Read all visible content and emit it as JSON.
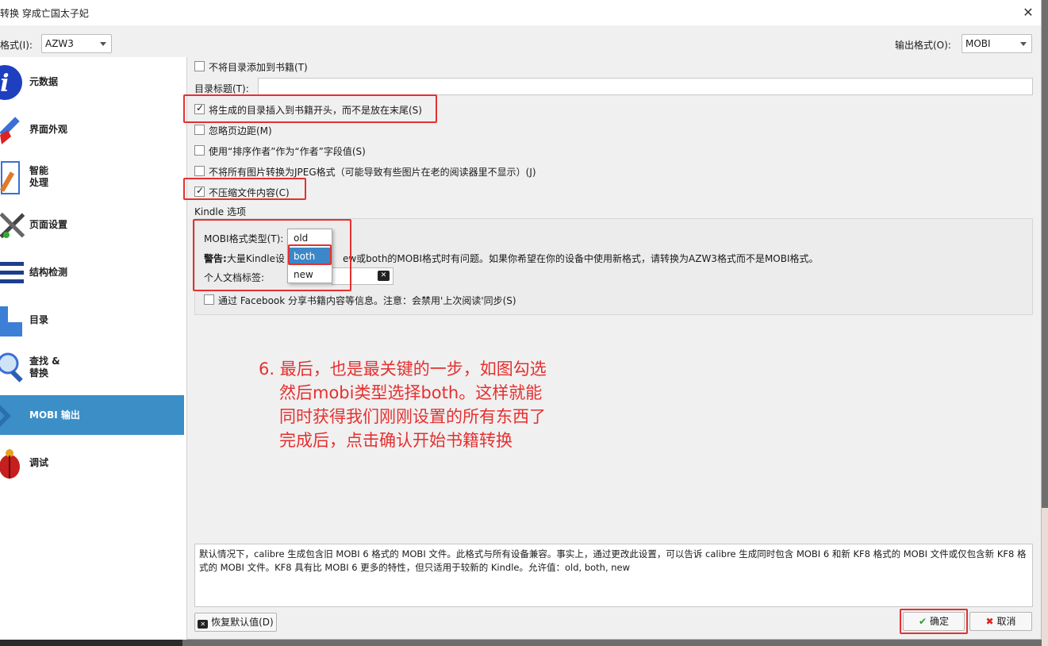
{
  "window": {
    "title": "转换 穿成亡国太子妃",
    "close_glyph": "✕"
  },
  "input_format": {
    "label": "格式(I):",
    "value": "AZW3"
  },
  "output_format": {
    "label": "输出格式(O):",
    "value": "MOBI"
  },
  "sidebar": {
    "items": [
      {
        "label": "元数据",
        "icon": "info-icon"
      },
      {
        "label": "界面外观",
        "icon": "brush-icon"
      },
      {
        "label": "智能\n处理",
        "icon": "document-edit-icon"
      },
      {
        "label": "页面设置",
        "icon": "tools-icon"
      },
      {
        "label": "结构检测",
        "icon": "structure-lines-icon"
      },
      {
        "label": "目录",
        "icon": "toc-pointer-icon"
      },
      {
        "label": "查找 &\n替换",
        "icon": "magnifier-icon"
      },
      {
        "label": "MOBI 输出",
        "icon": "mobi-chevron-icon"
      },
      {
        "label": "调试",
        "icon": "bug-icon"
      }
    ]
  },
  "options": {
    "no_toc": "不将目录添加到书籍(T)",
    "toc_title_label": "目录标题(T):",
    "toc_title_value": "",
    "toc_at_start": "将生成的目录插入到书籍开头，而不是放在末尾(S)",
    "ignore_margins": "忽略页边距(M)",
    "author_sort": "使用“排序作者”作为“作者”字段值(S)",
    "no_jpeg": "不将所有图片转换为JPEG格式（可能导致有些图片在老的阅读器里不显示）(J)",
    "dont_compress": "不压缩文件内容(C)"
  },
  "kindle": {
    "section_label": "Kindle 选项",
    "type_label": "MOBI格式类型(T):",
    "warning_bold": "警告:",
    "warning_start": "大量Kindle设",
    "warning_rest": "ew或both的MOBI格式时有问题。如果你希望在你的设备中使用新格式，请转换为AZW3格式而不是MOBI格式。",
    "tags_label": "个人文档标签:",
    "facebook": "通过 Facebook 分享书籍内容等信息。注意：会禁用'上次阅读'同步(S)",
    "dropdown_options": [
      "old",
      "both",
      "new"
    ],
    "selected": "both"
  },
  "annotation": {
    "line1": "6. 最后，也是最关键的一步，如图勾选",
    "line2": "然后mobi类型选择both。这样就能",
    "line3": "同时获得我们刚刚设置的所有东西了",
    "line4": "完成后，点击确认开始书籍转换"
  },
  "help_text": "默认情况下，calibre 生成包含旧 MOBI 6 格式的 MOBI 文件。此格式与所有设备兼容。事实上，通过更改此设置，可以告诉 calibre 生成同时包含 MOBI 6 和新 KF8 格式的 MOBI 文件或仅包含新 KF8 格式的 MOBI 文件。KF8 具有比 MOBI 6 更多的特性，但只适用于较新的 Kindle。允许值：old, both, new",
  "buttons": {
    "restore": "恢复默认值(D)",
    "ok": "确定",
    "cancel": "取消"
  },
  "colors": {
    "highlight_red": "#e53030",
    "active_sidebar": "#3c8ec7",
    "dropdown_selected": "#3b87c8"
  }
}
